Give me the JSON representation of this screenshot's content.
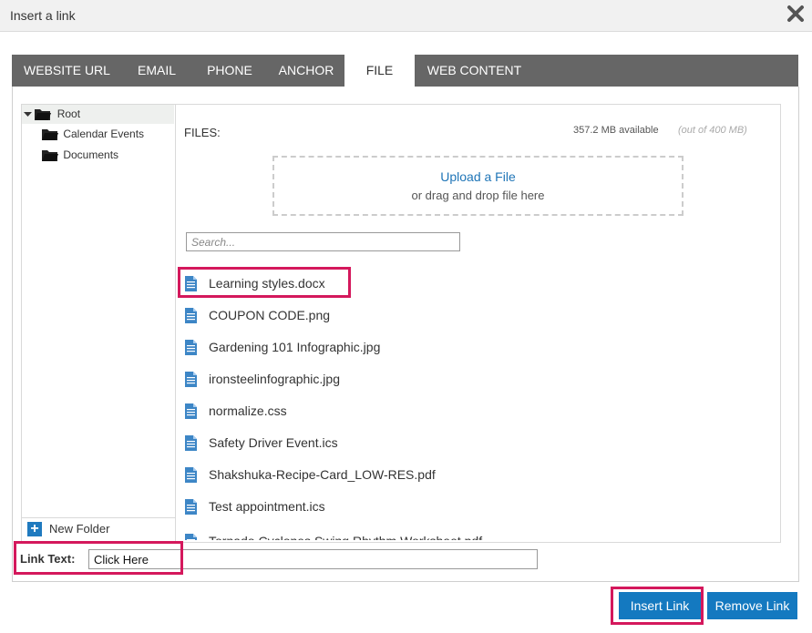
{
  "dialog": {
    "title": "Insert a link",
    "close_icon": "close-x-icon"
  },
  "tabs": [
    {
      "label": "WEBSITE URL",
      "active": false
    },
    {
      "label": "EMAIL",
      "active": false
    },
    {
      "label": "PHONE",
      "active": false
    },
    {
      "label": "ANCHOR",
      "active": false
    },
    {
      "label": "FILE",
      "active": true
    },
    {
      "label": "WEB CONTENT",
      "active": false
    }
  ],
  "folders": {
    "root": "Root",
    "children": [
      "Calendar Events",
      "Documents"
    ],
    "new_folder_label": "New Folder"
  },
  "files_panel": {
    "label": "FILES:",
    "available": "357.2 MB available",
    "out_of": "(out of 400 MB)",
    "upload_link": "Upload a File",
    "drag_hint": "or drag and drop file here",
    "search_placeholder": "Search...",
    "files": [
      "Learning styles.docx",
      "COUPON CODE.png",
      "Gardening 101 Infographic.jpg",
      "ironsteelinfographic.jpg",
      "normalize.css",
      "Safety Driver Event.ics",
      "Shakshuka-Recipe-Card_LOW-RES.pdf",
      "Test appointment.ics",
      "Tornado Cyclones Swing Rhythm Worksheet.pdf"
    ]
  },
  "link_text": {
    "label": "Link Text:",
    "value": "Click Here"
  },
  "buttons": {
    "insert": "Insert Link",
    "remove": "Remove Link"
  },
  "colors": {
    "accent": "#1479c0",
    "highlight": "#d4185c",
    "tabbar": "#666666"
  }
}
